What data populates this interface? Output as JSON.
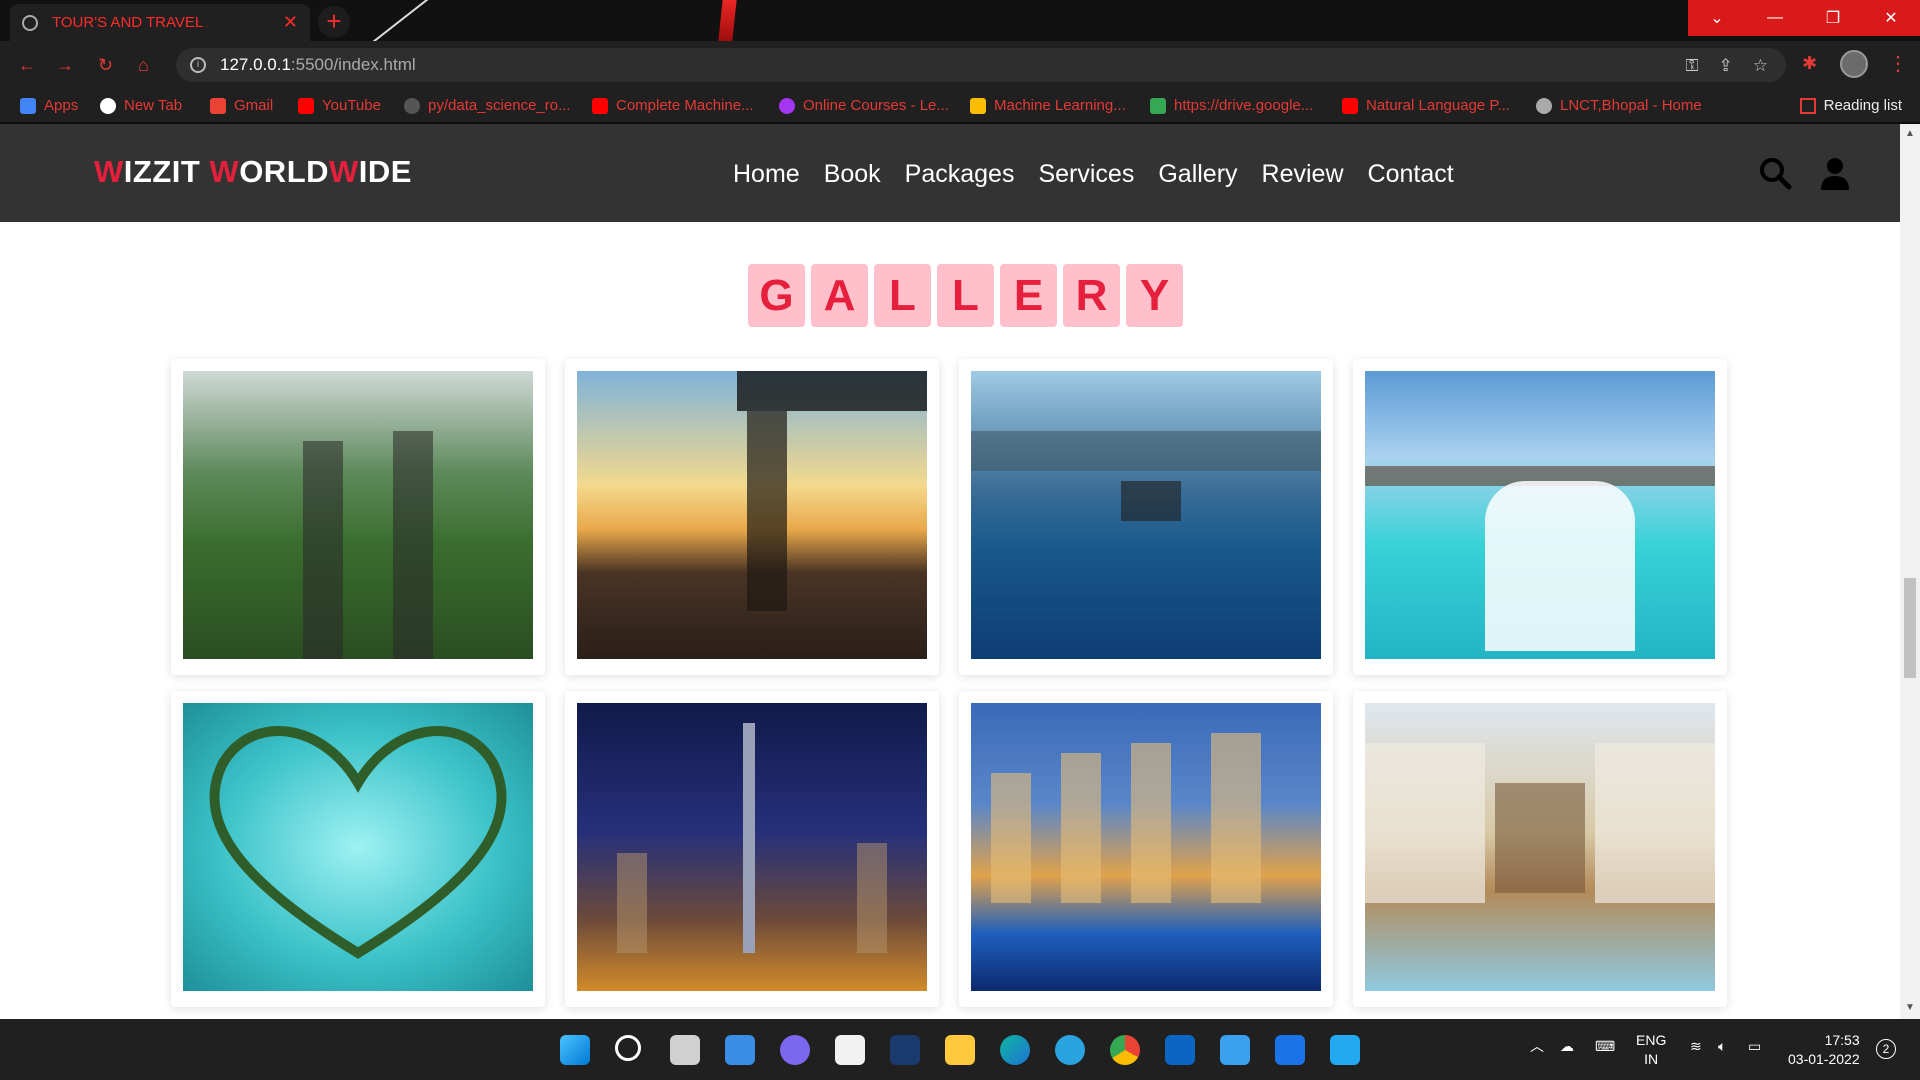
{
  "browser": {
    "tab_title": "TOUR'S AND TRAVEL",
    "tab_close": "✕",
    "new_tab": "+",
    "url_host": "127.0.0.1",
    "url_path": ":5500/index.html",
    "bookmarks": [
      {
        "label": "Apps",
        "icon": "apps-grid-icon",
        "color": "#4285f4"
      },
      {
        "label": "New Tab",
        "icon": "google-icon",
        "color": "#ffffff"
      },
      {
        "label": "Gmail",
        "icon": "gmail-icon",
        "color": "#ea4335"
      },
      {
        "label": "YouTube",
        "icon": "youtube-icon",
        "color": "#ff0000"
      },
      {
        "label": "py/data_science_ro...",
        "icon": "github-icon",
        "color": "#555555"
      },
      {
        "label": "Complete Machine...",
        "icon": "youtube-icon",
        "color": "#ff0000"
      },
      {
        "label": "Online Courses - Le...",
        "icon": "udemy-icon",
        "color": "#a435f0"
      },
      {
        "label": "Machine Learning...",
        "icon": "drive-icon",
        "color": "#fbbc04"
      },
      {
        "label": "https://drive.google...",
        "icon": "drive-icon",
        "color": "#34a853"
      },
      {
        "label": "Natural Language P...",
        "icon": "youtube-icon",
        "color": "#ff0000"
      },
      {
        "label": "LNCT,Bhopal - Home",
        "icon": "lnct-icon",
        "color": "#aaaaaa"
      }
    ],
    "reading_list": "Reading list"
  },
  "site": {
    "logo": {
      "p1": "W",
      "p2": "IZZIT ",
      "p3": "W",
      "p4": "ORLD",
      "p5": "W",
      "p6": "IDE"
    },
    "nav": [
      "Home",
      "Book",
      "Packages",
      "Services",
      "Gallery",
      "Review",
      "Contact"
    ],
    "gallery_letters": [
      "G",
      "A",
      "L",
      "L",
      "E",
      "R",
      "Y"
    ]
  },
  "colors": {
    "accent": "#e51f3c",
    "header_bg": "#333333",
    "title_tile": "#ffc0cb",
    "browser_red": "#e53935"
  },
  "taskbar": {
    "lang1": "ENG",
    "lang2": "IN",
    "time": "17:53",
    "date": "03-01-2022",
    "notifications": "2"
  }
}
